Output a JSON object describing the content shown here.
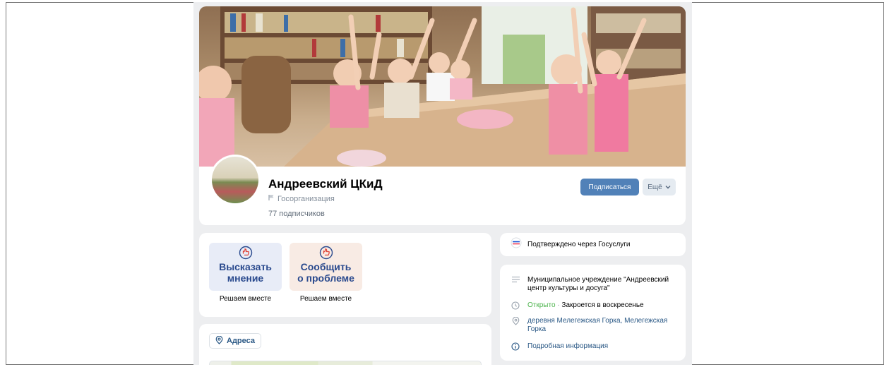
{
  "group": {
    "name": "Андреевский ЦКиД",
    "type": "Госорганизация",
    "subscribers": "77 подписчиков"
  },
  "buttons": {
    "subscribe": "Подписаться",
    "more": "Ещё"
  },
  "actions": [
    {
      "title_line1": "Высказать",
      "title_line2": "мнение",
      "caption": "Решаем вместе"
    },
    {
      "title_line1": "Сообщить",
      "title_line2": "о проблеме",
      "caption": "Решаем вместе"
    }
  ],
  "address": {
    "label": "Адреса"
  },
  "verified": {
    "text": "Подтверждено через Госуслуги"
  },
  "info": {
    "description": "Муниципальное учреждение \"Андреевский центр культуры и досуга\"",
    "status_open": "Открыто",
    "status_sep": " · ",
    "status_close": "Закроется в воскресенье",
    "location": "деревня Мелегежская Горка, Мелегежская Горка",
    "details": "Подробная информация"
  },
  "icons": {
    "flag": "flag-icon",
    "chevron": "chevron-down-icon",
    "hand": "hand-icon",
    "pin": "location-pin-icon",
    "gos": "gosuslugi-icon",
    "menu": "list-icon",
    "clock": "clock-icon",
    "info": "info-icon"
  },
  "colors": {
    "accent": "#5181b8",
    "link": "#2a5885",
    "open": "#4bb34b",
    "bg": "#edeef0"
  }
}
